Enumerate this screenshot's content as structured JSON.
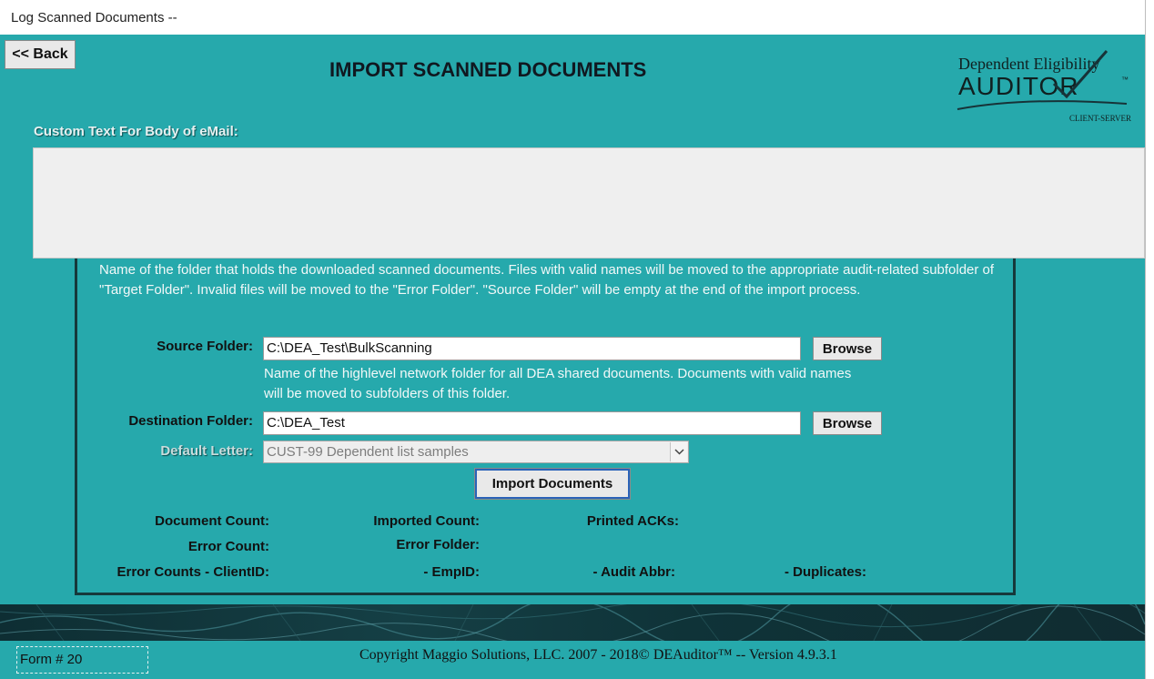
{
  "window": {
    "title": "Log Scanned Documents --"
  },
  "header": {
    "back_label": "<< Back",
    "page_title": "IMPORT SCANNED DOCUMENTS",
    "logo": {
      "line1": "Dependent Eligibility",
      "line2": "AUDITOR",
      "tm": "™",
      "line3": "CLIENT-SERVER"
    }
  },
  "email": {
    "label": "Custom Text For Body of eMail:",
    "value": ""
  },
  "import_panel": {
    "source_description": "Name of the folder that holds the downloaded scanned documents.  Files with valid names will be moved to the appropriate audit-related subfolder of \"Target Folder\".  Invalid files will be moved to  the \"Error Folder\".  \"Source Folder\" will be empty at the end of the import process.",
    "source_label": "Source Folder:",
    "source_value": "C:\\DEA_Test\\BulkScanning",
    "browse_label": "Browse",
    "destination_description": "Name of the highlevel network folder  for all DEA shared documents.  Documents with valid names will be moved to subfolders of this folder.",
    "destination_label": "Destination Folder:",
    "destination_value": "C:\\DEA_Test",
    "default_letter_label": "Default Letter:",
    "default_letter_value": "CUST-99 Dependent list samples",
    "import_button": "Import Documents"
  },
  "stats": {
    "document_count": "Document Count:",
    "error_count": "Error Count:",
    "error_counts_clientid": "Error Counts - ClientID:",
    "imported_count": "Imported Count:",
    "error_folder": "Error Folder:",
    "empid": "- EmpID:",
    "printed_acks": "Printed ACKs:",
    "audit_abbr": "- Audit Abbr:",
    "duplicates": "- Duplicates:"
  },
  "footer": {
    "form_number": "Form # 20",
    "copyright": "Copyright Maggio Solutions, LLC. 2007 - 2018©   DEAuditor™  -- Version  4.9.3.1"
  },
  "colors": {
    "background": "#26a9ac",
    "panel_border": "#16393b",
    "focus_border": "#2a63b8"
  },
  "icons": [
    "chevron-down-icon",
    "checkmark-swoosh-icon"
  ]
}
